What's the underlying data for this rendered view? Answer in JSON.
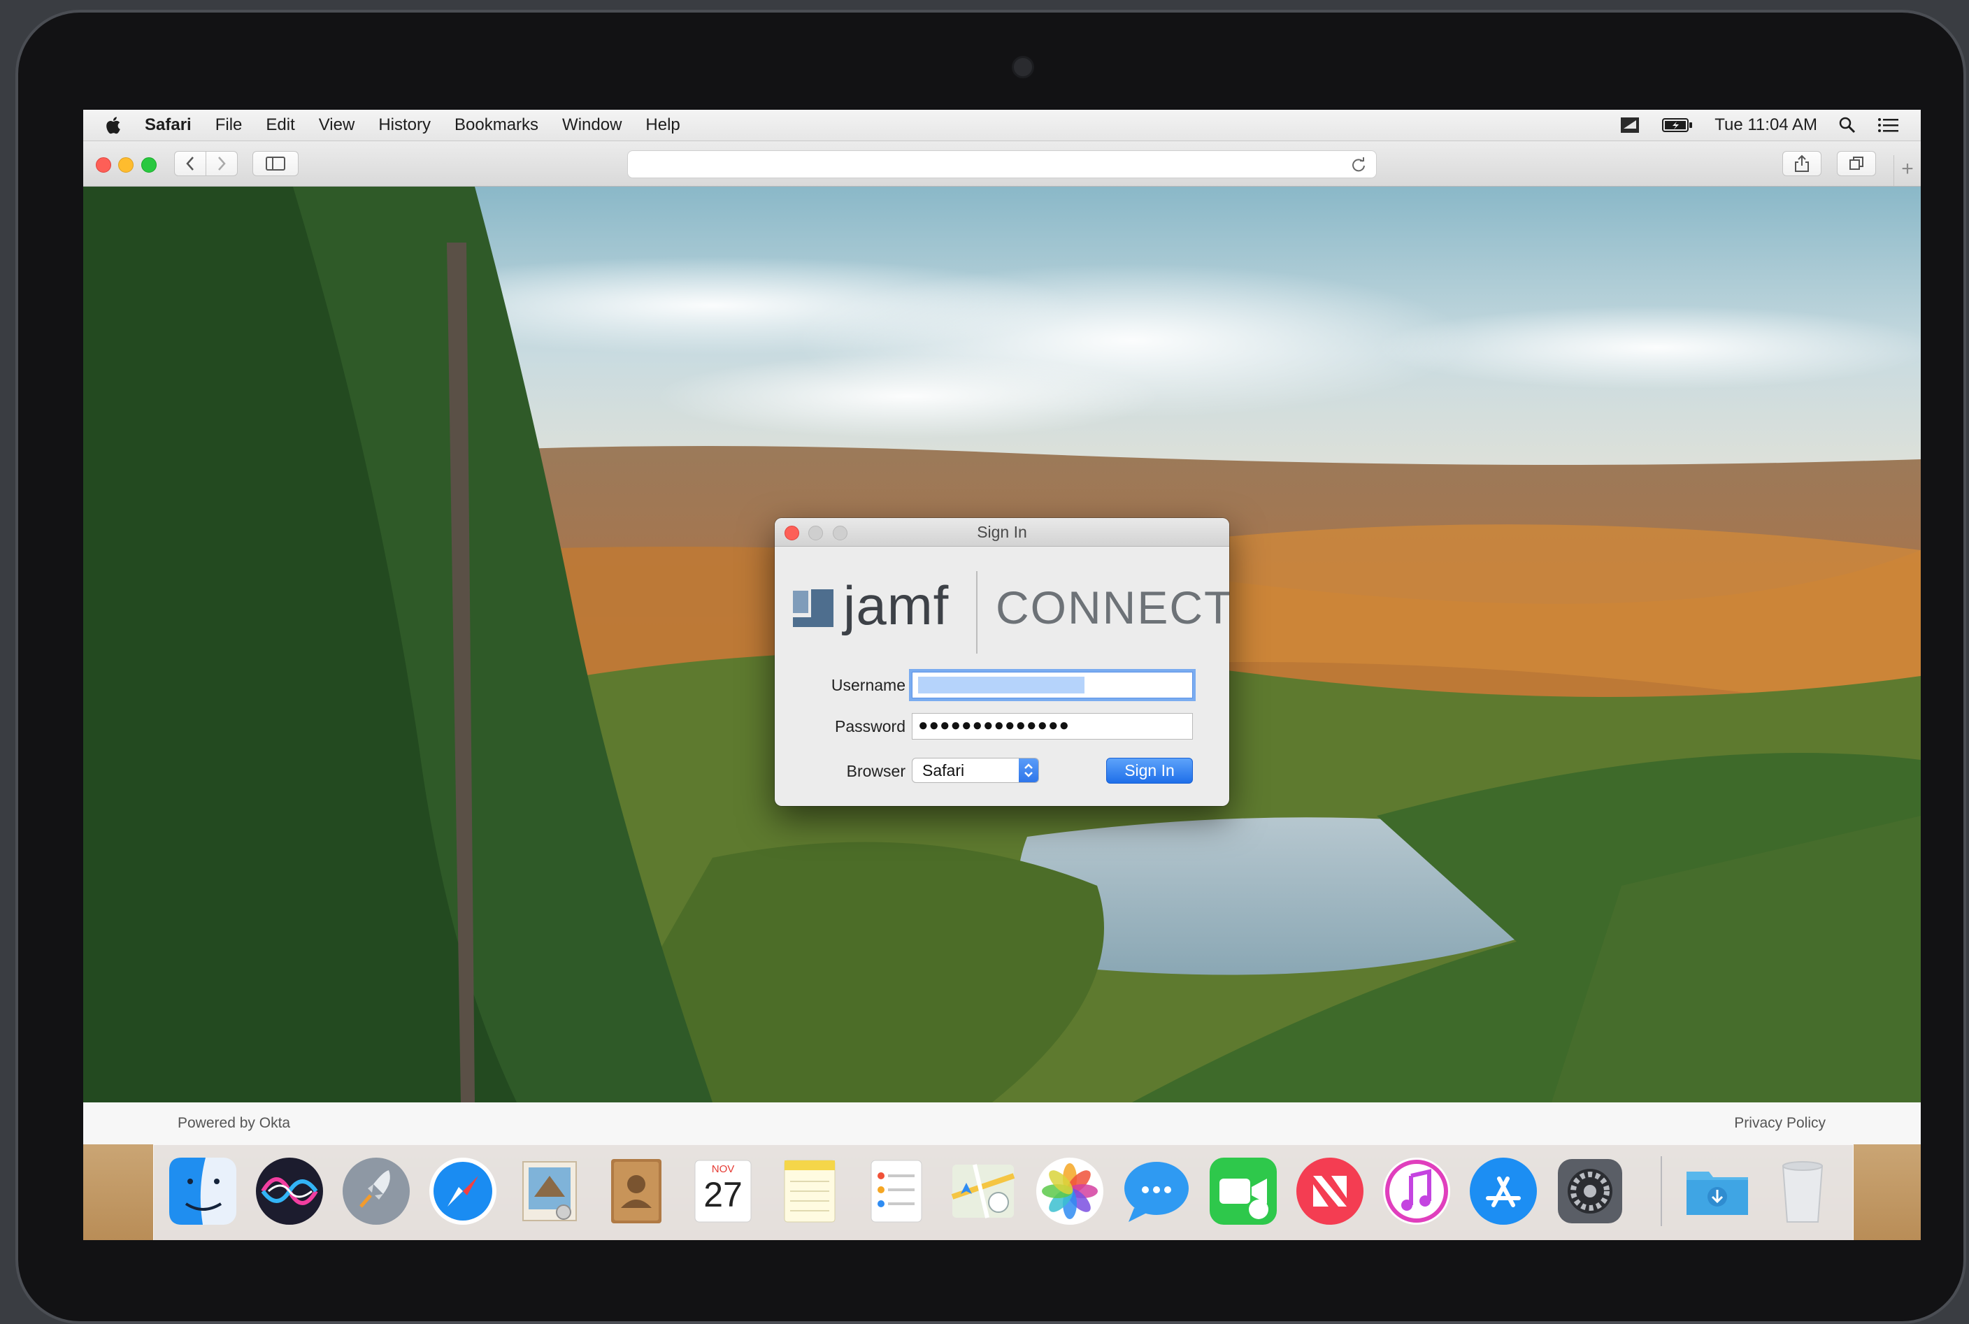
{
  "menubar": {
    "app_name": "Safari",
    "items": [
      "File",
      "Edit",
      "View",
      "History",
      "Bookmarks",
      "Window",
      "Help"
    ],
    "clock": "Tue 11:04 AM",
    "icons": [
      "jamf-connect-menu-icon",
      "battery-icon",
      "spotlight-icon",
      "notification-center-icon"
    ]
  },
  "toolbar": {
    "url": "",
    "buttons": [
      "back-button",
      "forward-button",
      "sidebar-button",
      "reload-button",
      "share-button",
      "tabs-button",
      "new-tab-button"
    ]
  },
  "dialog": {
    "title": "Sign In",
    "logo_brand": "jamf",
    "logo_product": "CONNECT",
    "username_label": "Username",
    "username_value": "",
    "password_label": "Password",
    "password_value": "●●●●●●●●●●●●●●",
    "browser_label": "Browser",
    "browser_selected": "Safari",
    "signin_button": "Sign In"
  },
  "footer": {
    "left": "Powered by Okta",
    "right": "Privacy Policy"
  },
  "dock": {
    "calendar_month": "NOV",
    "calendar_day": "27",
    "apps": [
      "finder-icon",
      "siri-icon",
      "launchpad-icon",
      "safari-icon",
      "mail-icon",
      "contacts-icon",
      "calendar-icon",
      "notes-icon",
      "reminders-icon",
      "maps-icon",
      "photos-icon",
      "messages-icon",
      "facetime-icon",
      "news-icon",
      "itunes-icon",
      "app-store-icon",
      "system-preferences-icon",
      "downloads-folder-icon",
      "trash-icon"
    ]
  },
  "colors": {
    "accent_blue": "#2f76ea",
    "traffic_red": "#fd5f57",
    "traffic_yellow": "#febc2e",
    "traffic_green": "#29c840"
  }
}
